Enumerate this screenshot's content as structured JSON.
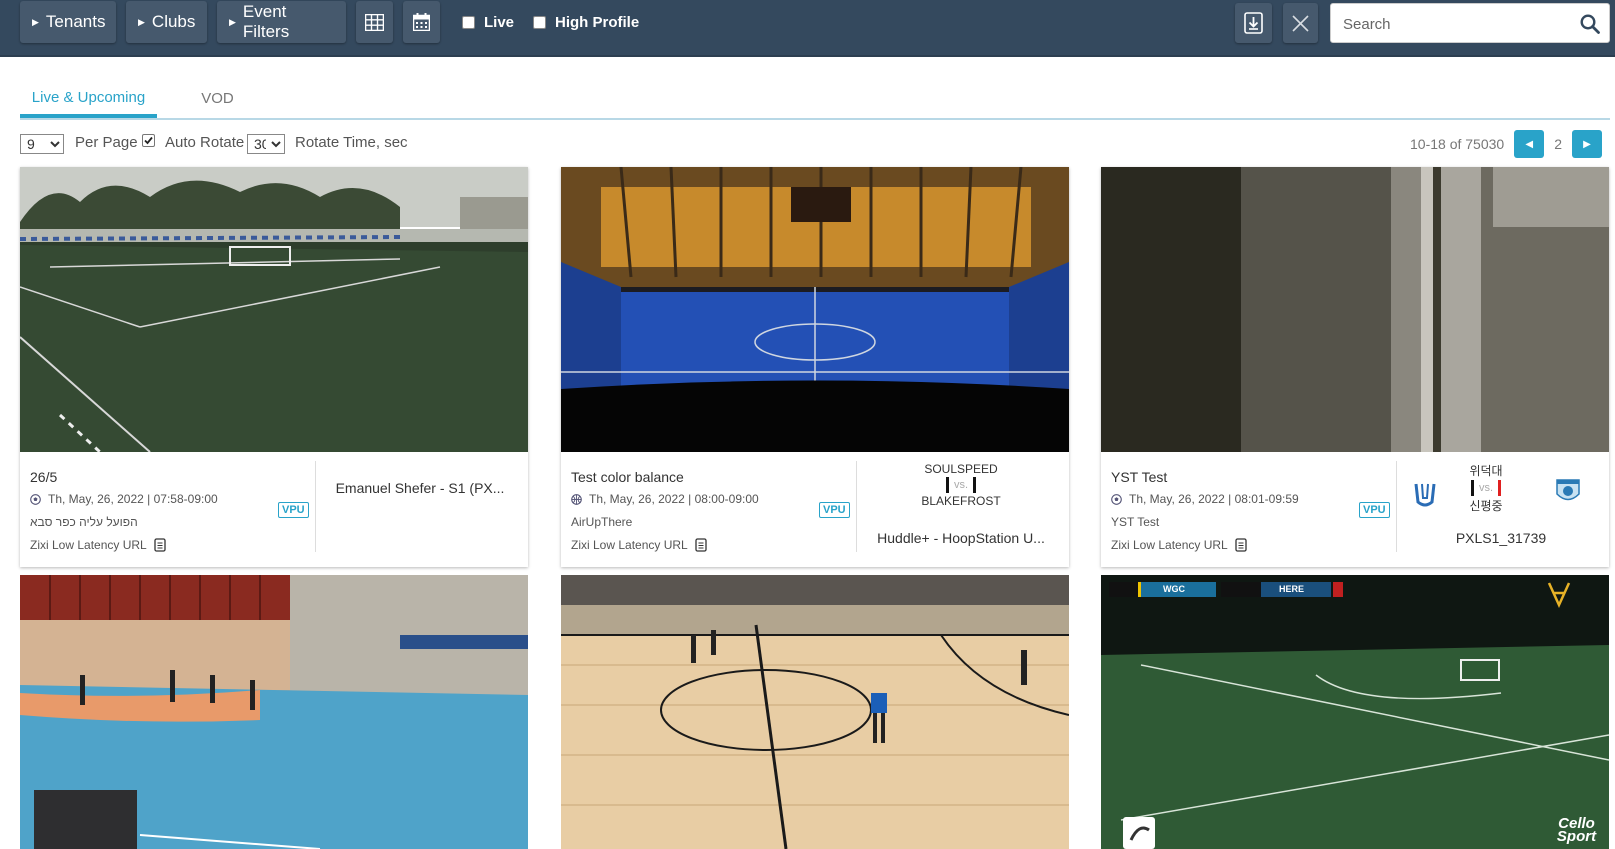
{
  "toolbar": {
    "tenants_label": "Tenants",
    "clubs_label": "Clubs",
    "event_filters_label": "Event Filters",
    "live_label": "Live",
    "high_profile_label": "High Profile"
  },
  "search": {
    "placeholder": "Search"
  },
  "tabs": [
    {
      "label": "Live & Upcoming",
      "active": true
    },
    {
      "label": "VOD",
      "active": false
    }
  ],
  "controls": {
    "per_page_value": "9",
    "per_page_label": "Per Page",
    "auto_rotate_label": "Auto Rotate",
    "auto_rotate_checked": true,
    "rotate_time_value": "30",
    "rotate_time_label": "Rotate Time, sec"
  },
  "pagination": {
    "range_text": "10-18 of 75030",
    "current_page": "2"
  },
  "events": [
    {
      "title": "26/5",
      "date": "Th, May, 26, 2022 | 07:58-09:00",
      "tenant": "הפועל עליה כפר סבא",
      "zixi": "Zixi Low Latency URL",
      "vpu": "VPU",
      "device": "Emanuel Shefer - S1 (PX..."
    },
    {
      "title": "Test color balance",
      "date": "Th, May, 26, 2022 | 08:00-09:00",
      "tenant": "AirUpThere",
      "zixi": "Zixi Low Latency URL",
      "vpu": "VPU",
      "home_team": "SOULSPEED",
      "vs": "vs.",
      "away_team": "BLAKEFROST",
      "device": "Huddle+ - HoopStation U..."
    },
    {
      "title": "YST Test",
      "date": "Th, May, 26, 2022 | 08:01-09:59",
      "tenant": "YST Test",
      "zixi": "Zixi Low Latency URL",
      "vpu": "VPU",
      "home_team": "위덕대",
      "vs": "vs.",
      "away_team": "신평중",
      "device": "PXLS1_31739"
    }
  ],
  "overlays": {
    "score_home": "WGC",
    "score_away": "HERE",
    "watermark": "Cello Sport"
  },
  "colors": {
    "topbar": "#34495e",
    "button": "#46596d",
    "accent": "#29a3c9"
  }
}
